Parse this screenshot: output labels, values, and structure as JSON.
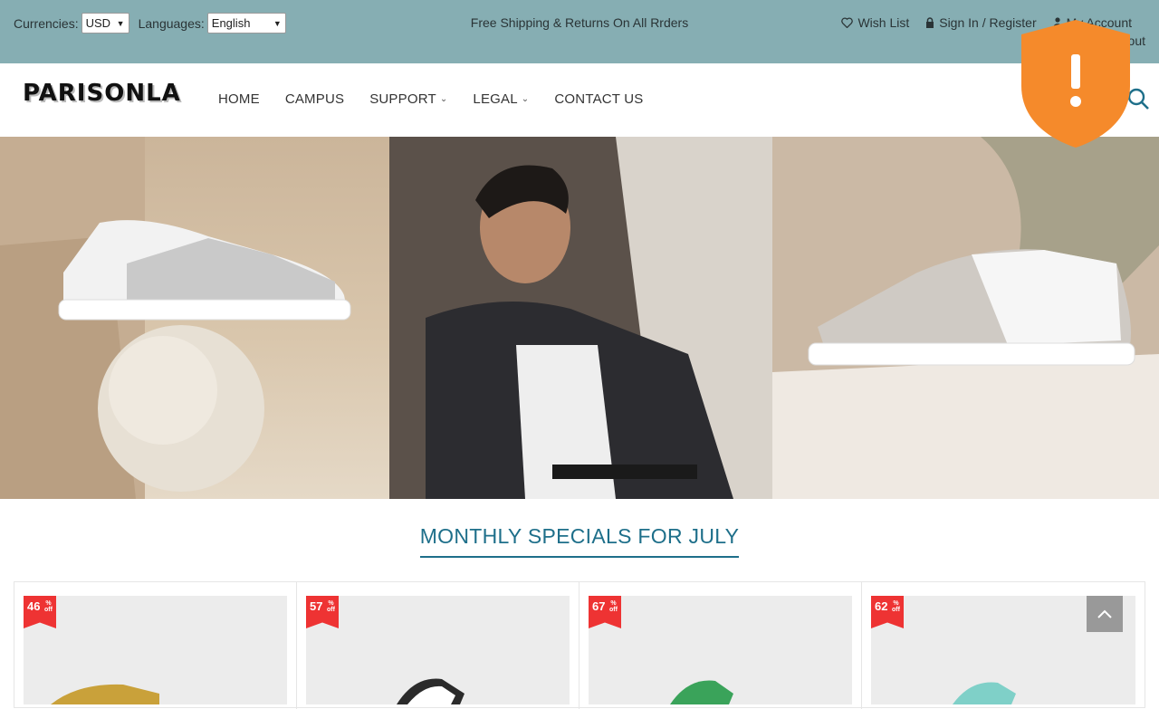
{
  "topbar": {
    "currency_label": "Currencies:",
    "currency_value": "USD",
    "language_label": "Languages:",
    "language_value": "English",
    "shipping_notice": "Free Shipping & Returns On All Rrders",
    "wishlist": "Wish List",
    "signin": "Sign In / Register",
    "account": "My Account",
    "logout": "Logout"
  },
  "header": {
    "logo": "PARISONLA",
    "nav": [
      {
        "label": "HOME"
      },
      {
        "label": "CAMPUS"
      },
      {
        "label": "SUPPORT"
      },
      {
        "label": "LEGAL"
      },
      {
        "label": "CONTACT US"
      }
    ]
  },
  "section": {
    "title": "MONTHLY SPECIALS FOR JULY"
  },
  "products": [
    {
      "discount": "46",
      "off": "% off",
      "shoe_color": "#c9a13a"
    },
    {
      "discount": "57",
      "off": "% off",
      "shoe_color": "#2b2b2b"
    },
    {
      "discount": "67",
      "off": "% off",
      "shoe_color": "#3aa35a"
    },
    {
      "discount": "62",
      "off": "% off",
      "shoe_color": "#7fd0c8"
    }
  ],
  "colors": {
    "topbar_bg": "#86aeb3",
    "accent": "#1e6f8a",
    "badge": "#e33333",
    "shield": "#f58a2b"
  }
}
